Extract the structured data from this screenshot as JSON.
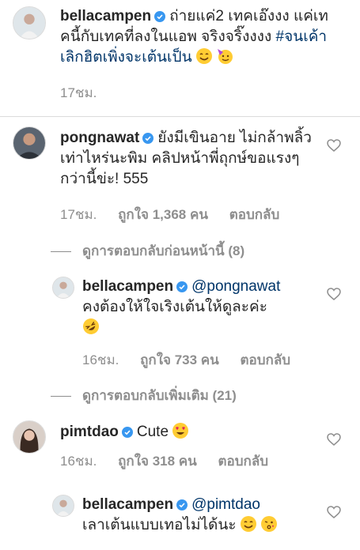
{
  "comments": [
    {
      "username": "bellacampen",
      "text": "ถ่ายแค่2 เทคเอ๊งงง แค่เทคนี้กับเทคที่ลงในแอพ จริงจริ๊งงงง ",
      "hashtag": "#จนเค้าเลิกฮิตเพิ่งจะเต้นเป็น",
      "emojis": [
        "smiling-face-emoji",
        "party-face-emoji"
      ],
      "time": "17ชม."
    },
    {
      "username": "pongnawat",
      "text": "ยังมีเขินอาย ไม่กล้าพลิ้วเท่าไหร่นะพิม คลิปหน้าพี่ถุกษ์ขอแรงๆ กว่านี้ข่ะ! 555",
      "time": "17ชม.",
      "likes": "ถูกใจ 1,368 คน",
      "reply": "ตอบกลับ",
      "view_previous": "ดูการตอบกลับก่อนหน้านี้ (8)"
    },
    {
      "username": "bellacampen",
      "mention": "@pongnawat",
      "text": "คงต้องให้ใจเริงเต้นให้ดูละค่ะ",
      "emojis": [
        "rofl-face-emoji"
      ],
      "time": "16ชม.",
      "likes": "ถูกใจ 733 คน",
      "reply": "ตอบกลับ",
      "view_more": "ดูการตอบกลับเพิ่มเติม (21)"
    },
    {
      "username": "pimtdao",
      "text": "Cute",
      "emojis": [
        "heart-eyes-emoji"
      ],
      "time": "16ชม.",
      "likes": "ถูกใจ 318 คน",
      "reply": "ตอบกลับ"
    },
    {
      "username": "bellacampen",
      "mention": "@pimtdao",
      "text": "เลาเต้นแบบเทอไม่ได้นะ",
      "emojis": [
        "smiling-face-emoji",
        "kissing-face-emoji"
      ]
    }
  ],
  "colors": {
    "text": "#262626",
    "muted": "#8e8e8e",
    "link": "#003569",
    "verified": "#3897f0",
    "emoji": "#ffcc33"
  }
}
